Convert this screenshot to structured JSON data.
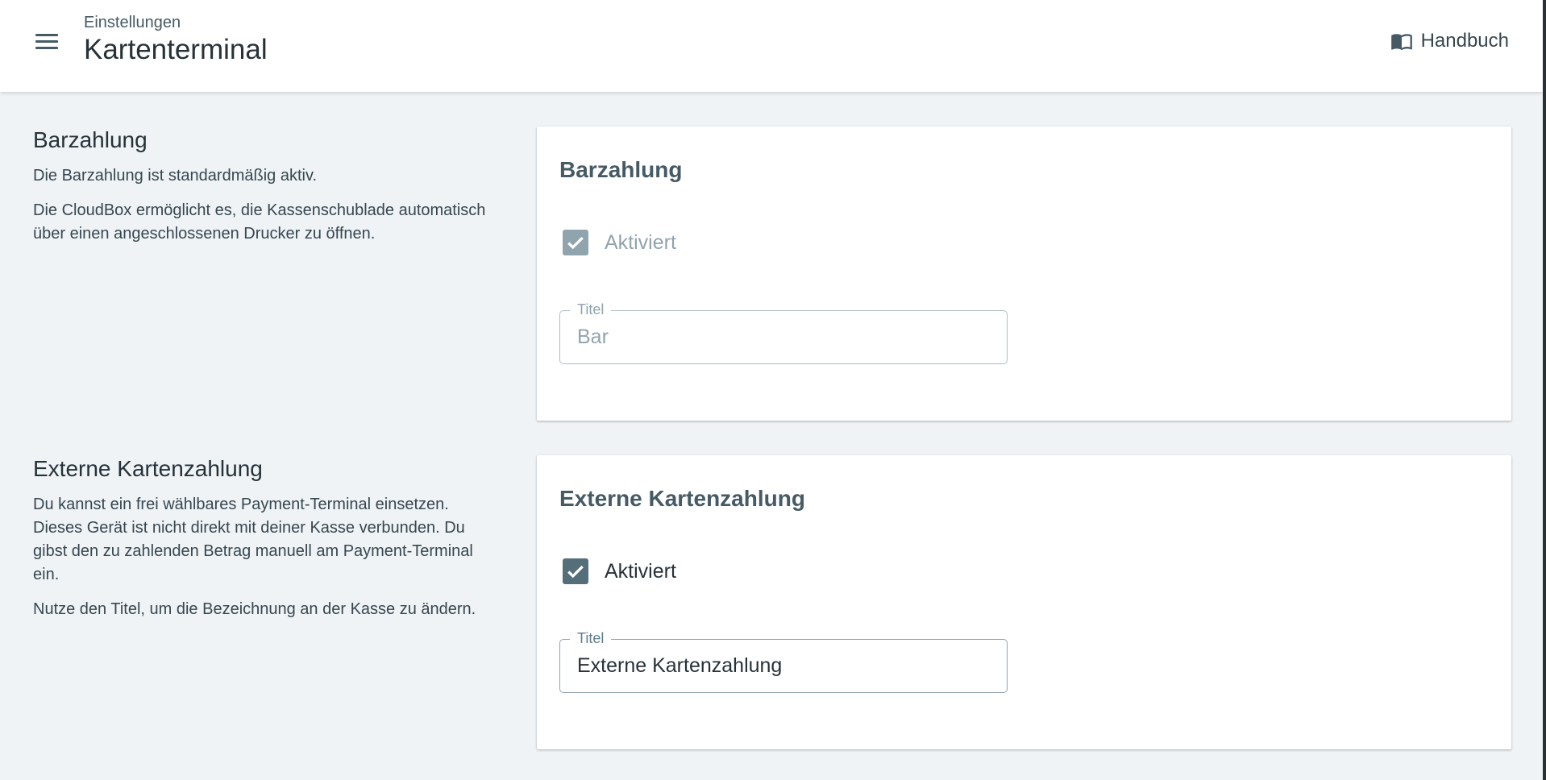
{
  "header": {
    "breadcrumb": "Einstellungen",
    "title": "Kartenterminal",
    "manual_label": "Handbuch"
  },
  "sections": [
    {
      "heading": "Barzahlung",
      "paragraphs": [
        "Die Barzahlung ist standardmäßig aktiv.",
        "Die CloudBox ermöglicht es, die Kassenschublade automatisch über einen angeschlossenen Drucker zu öffnen."
      ],
      "card": {
        "title": "Barzahlung",
        "checkbox_label": "Aktiviert",
        "checked": true,
        "disabled": true,
        "field_label": "Titel",
        "field_value": "Bar"
      }
    },
    {
      "heading": "Externe Kartenzahlung",
      "paragraphs": [
        "Du kannst ein frei wählbares Payment-Terminal einsetzen. Dieses Gerät ist nicht direkt mit deiner Kasse verbunden. Du gibst den zu zahlenden Betrag manuell am Payment-Terminal ein.",
        "Nutze den Titel, um die Bezeichnung an der Kasse zu ändern."
      ],
      "card": {
        "title": "Externe Kartenzahlung",
        "checkbox_label": "Aktiviert",
        "checked": true,
        "disabled": false,
        "field_label": "Titel",
        "field_value": "Externe Kartenzahlung"
      }
    }
  ],
  "colors": {
    "background": "#eff3f6",
    "primary": "#546e7a",
    "disabled": "#90a4ae"
  },
  "icons": {
    "menu": "menu-icon",
    "manual": "book-open-icon",
    "check": "check-icon"
  }
}
